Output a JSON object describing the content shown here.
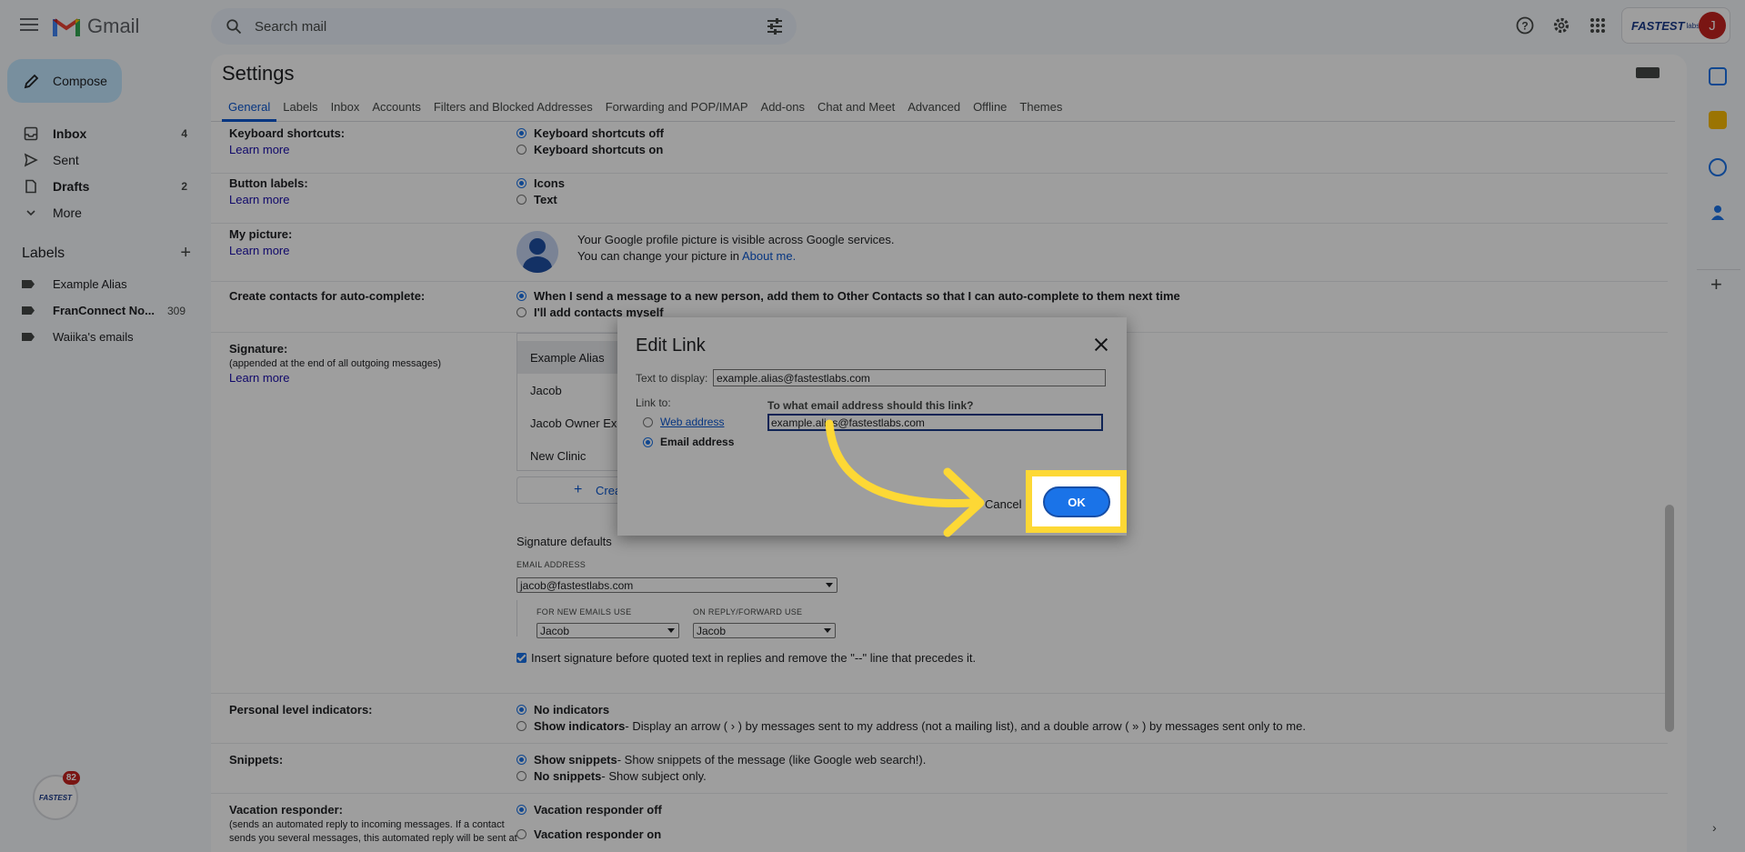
{
  "app": {
    "title": "Gmail"
  },
  "search": {
    "placeholder": "Search mail"
  },
  "account": {
    "brand": "FASTEST",
    "brand_suffix": "labs",
    "avatar_letter": "J"
  },
  "compose": {
    "label": "Compose"
  },
  "nav": [
    {
      "label": "Inbox",
      "count": "4",
      "bold": true,
      "icon": "inbox-icon"
    },
    {
      "label": "Sent",
      "count": "",
      "bold": false,
      "icon": "send-icon"
    },
    {
      "label": "Drafts",
      "count": "2",
      "bold": true,
      "icon": "draft-icon"
    },
    {
      "label": "More",
      "count": "",
      "bold": false,
      "icon": "chevron-down-icon"
    }
  ],
  "labels": {
    "heading": "Labels",
    "items": [
      {
        "label": "Example Alias",
        "count": "",
        "bold": false
      },
      {
        "label": "FranConnect No...",
        "count": "309",
        "bold": true
      },
      {
        "label": "Waiika's emails",
        "count": "",
        "bold": false
      }
    ]
  },
  "notif_badge": "82",
  "settings": {
    "title": "Settings",
    "tabs": [
      "General",
      "Labels",
      "Inbox",
      "Accounts",
      "Filters and Blocked Addresses",
      "Forwarding and POP/IMAP",
      "Add-ons",
      "Chat and Meet",
      "Advanced",
      "Offline",
      "Themes"
    ],
    "learn_more": "Learn more",
    "keyboard": {
      "label": "Keyboard shortcuts:",
      "off": "Keyboard shortcuts off",
      "on": "Keyboard shortcuts on"
    },
    "button_labels": {
      "label": "Button labels:",
      "icons": "Icons",
      "text": "Text"
    },
    "picture": {
      "label": "My picture:",
      "line1": "Your Google profile picture is visible across Google services.",
      "line2": "You can change your picture in",
      "link": "About me."
    },
    "contacts": {
      "label": "Create contacts for auto-complete:",
      "opt1": "When I send a message to a new person, add them to Other Contacts so that I can auto-complete to them next time",
      "opt2": "I'll add contacts myself"
    },
    "signature": {
      "label": "Signature:",
      "sub": "(appended at the end of all outgoing messages)",
      "items": [
        "Example Alias",
        "Jacob",
        "Jacob Owner Ex...",
        "New Clinic"
      ],
      "create": "Crea",
      "defaults": "Signature defaults",
      "email_cap": "EMAIL ADDRESS",
      "email_val": "jacob@fastestlabs.com",
      "new_cap": "FOR NEW EMAILS USE",
      "new_val": "Jacob",
      "reply_cap": "ON REPLY/FORWARD USE",
      "reply_val": "Jacob",
      "insert": "Insert signature before quoted text in replies and remove the \"--\" line that precedes it."
    },
    "personal": {
      "label": "Personal level indicators:",
      "opt1": "No indicators",
      "opt2_b": "Show indicators",
      "opt2": " - Display an arrow ( › ) by messages sent to my address (not a mailing list), and a double arrow ( » ) by messages sent only to me."
    },
    "snippets": {
      "label": "Snippets:",
      "opt1_b": "Show snippets",
      "opt1": " - Show snippets of the message (like Google web search!).",
      "opt2_b": "No snippets",
      "opt2": " - Show subject only."
    },
    "vacation": {
      "label": "Vacation responder:",
      "sub1": "(sends an automated reply to incoming messages. If a contact",
      "sub2": "sends you several messages, this automated reply will be sent at",
      "opt1": "Vacation responder off",
      "opt2": "Vacation responder on"
    }
  },
  "dialog": {
    "title": "Edit Link",
    "text_label": "Text to display:",
    "text_value": "example.alias@fastestlabs.com",
    "link_to": "Link to:",
    "web": "Web address",
    "email": "Email address",
    "question": "To what email address should this link?",
    "email_value": "example.alias@fastestlabs.com",
    "cancel": "Cancel",
    "ok": "OK"
  },
  "colors": {
    "accent": "#1a73e8",
    "highlight": "#fdd835",
    "compose_bg": "#c2e7ff"
  }
}
